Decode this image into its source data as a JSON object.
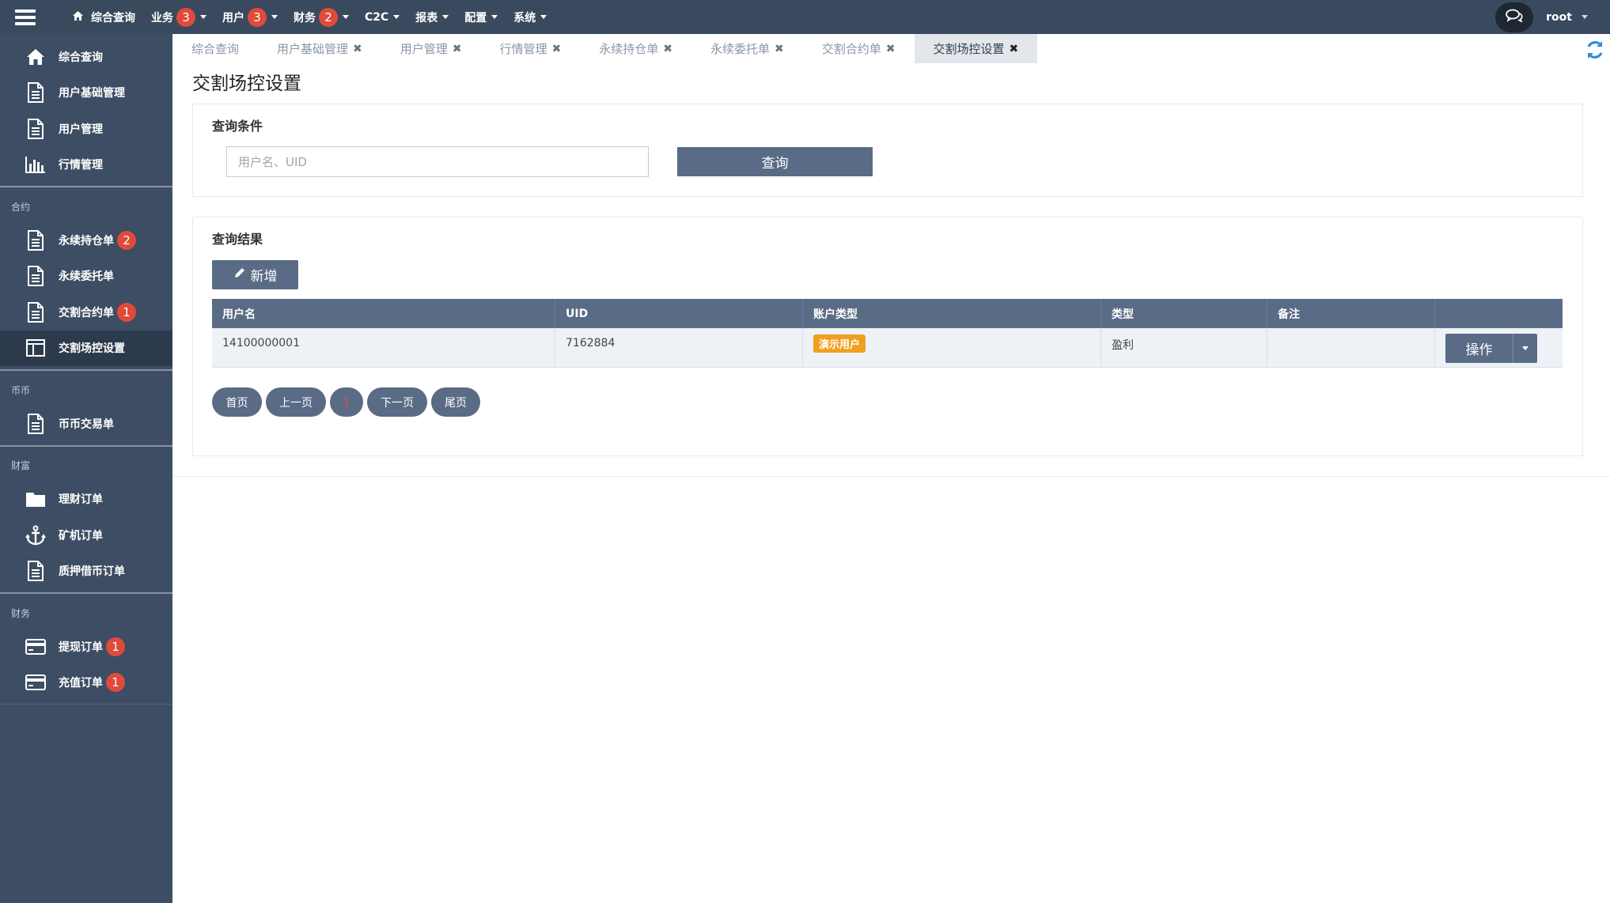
{
  "topnav": {
    "items": [
      {
        "label": "综合查询",
        "icon": "home-icon",
        "badge": null,
        "dropdown": false
      },
      {
        "label": "业务",
        "badge": "3",
        "dropdown": true
      },
      {
        "label": "用户",
        "badge": "3",
        "dropdown": true
      },
      {
        "label": "财务",
        "badge": "2",
        "dropdown": true
      },
      {
        "label": "C2C",
        "badge": null,
        "dropdown": true
      },
      {
        "label": "报表",
        "badge": null,
        "dropdown": true
      },
      {
        "label": "配置",
        "badge": null,
        "dropdown": true
      },
      {
        "label": "系统",
        "badge": null,
        "dropdown": true
      }
    ],
    "user": "root"
  },
  "sidebar": {
    "group0": [
      {
        "label": "综合查询",
        "icon": "home-icon"
      },
      {
        "label": "用户基础管理",
        "icon": "document-icon"
      },
      {
        "label": "用户管理",
        "icon": "document-icon"
      },
      {
        "label": "行情管理",
        "icon": "bar-chart-icon"
      }
    ],
    "section1": "合约",
    "group1": [
      {
        "label": "永续持仓单",
        "icon": "document-icon",
        "badge": "2"
      },
      {
        "label": "永续委托单",
        "icon": "document-icon"
      },
      {
        "label": "交割合约单",
        "icon": "document-icon",
        "badge": "1"
      },
      {
        "label": "交割场控设置",
        "icon": "columns-icon",
        "active": true
      }
    ],
    "section2": "币币",
    "group2": [
      {
        "label": "币币交易单",
        "icon": "document-icon"
      }
    ],
    "section3": "财富",
    "group3": [
      {
        "label": "理财订单",
        "icon": "folder-icon"
      },
      {
        "label": "矿机订单",
        "icon": "anchor-icon"
      },
      {
        "label": "质押借币订单",
        "icon": "document-icon"
      }
    ],
    "section4": "财务",
    "group4": [
      {
        "label": "提现订单",
        "icon": "credit-card-icon",
        "badge": "1"
      },
      {
        "label": "充值订单",
        "icon": "credit-card-icon",
        "badge": "1"
      }
    ]
  },
  "tabs": [
    {
      "label": "综合查询",
      "closable": false
    },
    {
      "label": "用户基础管理",
      "closable": true
    },
    {
      "label": "用户管理",
      "closable": true
    },
    {
      "label": "行情管理",
      "closable": true
    },
    {
      "label": "永续持仓单",
      "closable": true
    },
    {
      "label": "永续委托单",
      "closable": true
    },
    {
      "label": "交割合约单",
      "closable": true
    },
    {
      "label": "交割场控设置",
      "closable": true,
      "active": true
    }
  ],
  "page": {
    "title": "交割场控设置"
  },
  "query": {
    "title": "查询条件",
    "placeholder": "用户名、UID",
    "button": "查询"
  },
  "results": {
    "title": "查询结果",
    "add_button": "新增",
    "columns": [
      "用户名",
      "UID",
      "账户类型",
      "类型",
      "备注",
      ""
    ],
    "rows": [
      {
        "username": "14100000001",
        "uid": "7162884",
        "account_type": "演示用户",
        "type": "盈利",
        "note": "",
        "op": "操作"
      }
    ]
  },
  "pagination": {
    "first": "首页",
    "prev": "上一页",
    "current": "1",
    "next": "下一页",
    "last": "尾页"
  },
  "colors": {
    "topbar": "#3a4a5e",
    "sidebar": "#3d4d63",
    "primary_button": "#5a6b85",
    "badge": "#e04a3a",
    "tag_orange": "#f0a020",
    "refresh_blue": "#2b8ee0"
  }
}
